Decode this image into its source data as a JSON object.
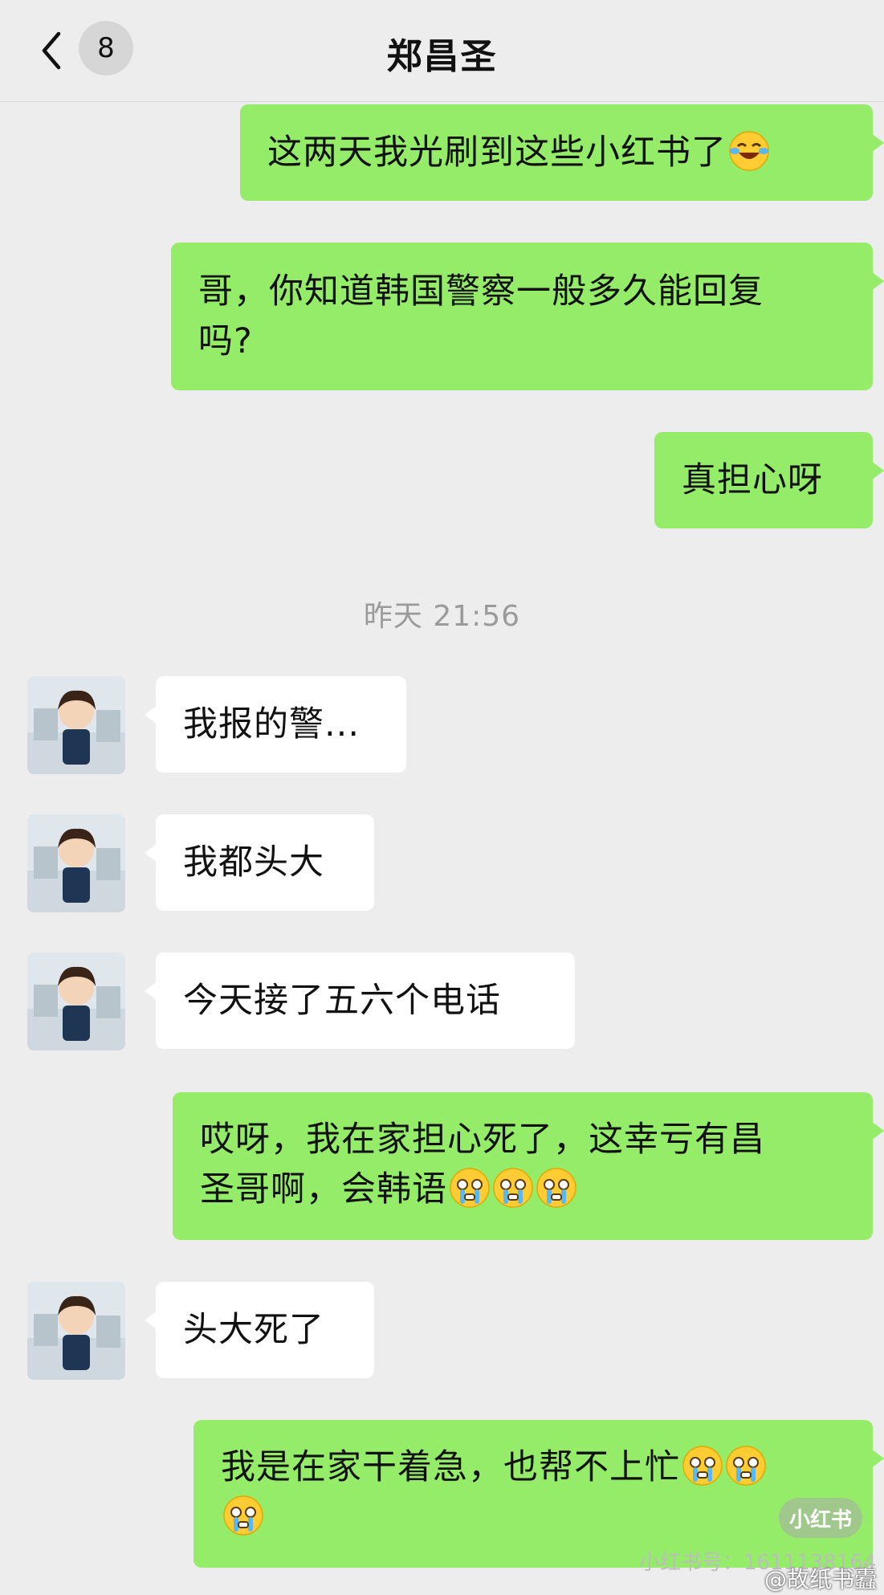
{
  "header": {
    "back_icon": "chevron-left-icon",
    "unread_count": "8",
    "title": "郑昌圣"
  },
  "messages": [
    {
      "side": "out",
      "text": "这两天我光刷到这些小红书了",
      "emoji": [
        "laugh-cry-emoji"
      ]
    },
    {
      "side": "out",
      "line1": "哥，你知道韩国警察一般多久能回复",
      "line2": "吗?"
    },
    {
      "side": "out",
      "text": "真担心呀"
    },
    {
      "side": "in",
      "text": "我报的警..."
    },
    {
      "side": "in",
      "text": "我都头大"
    },
    {
      "side": "in",
      "text": "今天接了五六个电话"
    },
    {
      "side": "out",
      "line1": "哎呀，我在家担心死了，这幸亏有昌",
      "line2": "圣哥啊，会韩语",
      "emoji": [
        "crying-emoji",
        "crying-emoji",
        "crying-emoji"
      ]
    },
    {
      "side": "in",
      "text": "头大死了"
    },
    {
      "side": "out",
      "line1": "我是在家干着急，也帮不上忙",
      "emoji": [
        "crying-emoji",
        "crying-emoji",
        "crying-emoji"
      ]
    }
  ],
  "timestamp": "昨天 21:56",
  "watermark": {
    "logo": "小红书",
    "id_text": "小红书号：1611138164",
    "weibo": "@故纸书蠹"
  },
  "colors": {
    "outgoing_bubble": "#95ec69",
    "incoming_bubble": "#ffffff",
    "background": "#ededed"
  }
}
